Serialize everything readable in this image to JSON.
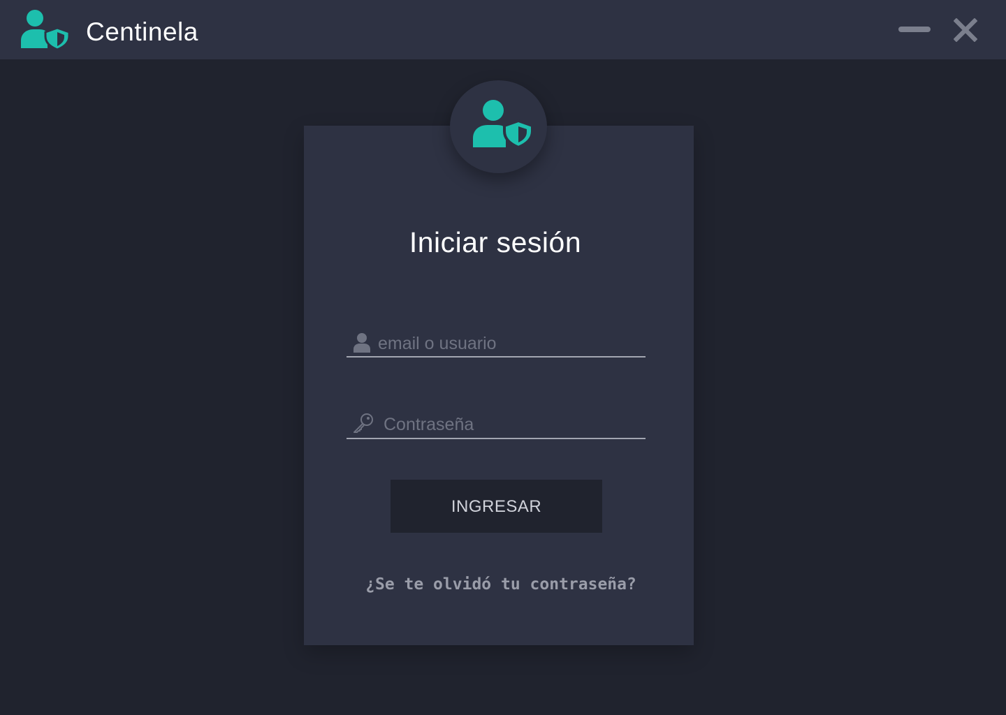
{
  "window": {
    "title": "Centinela",
    "logo_icon": "user-shield-icon",
    "minimize_icon": "minimize-icon",
    "close_icon": "close-icon"
  },
  "login": {
    "avatar_icon": "user-shield-icon",
    "title": "Iniciar sesión",
    "username": {
      "icon": "user-icon",
      "placeholder": "email o usuario",
      "value": ""
    },
    "password": {
      "icon": "key-icon",
      "placeholder": "Contraseña",
      "value": ""
    },
    "submit_label": "INGRESAR",
    "forgot_label": "¿Se te olvidó tu contraseña?"
  },
  "colors": {
    "accent": "#1dbfad",
    "titlebar_bg": "#2e3243",
    "window_bg": "#20232e",
    "card_bg": "#2e3243",
    "button_bg": "#20232e",
    "control_gray": "#7b7f8d"
  }
}
